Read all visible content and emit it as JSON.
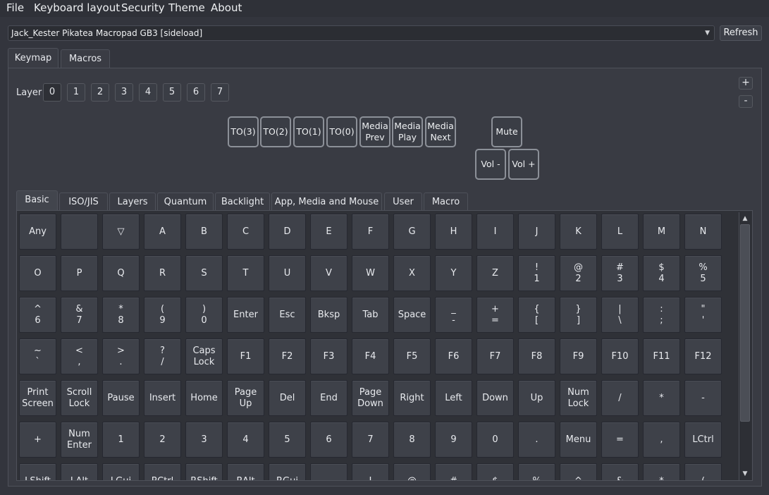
{
  "menu": [
    "File",
    "Keyboard layout",
    "Security",
    "Theme",
    "About"
  ],
  "device": {
    "selected": "Jack_Kester Pikatea Macropad GB3 [sideload]",
    "refresh_label": "Refresh"
  },
  "top_tabs": [
    {
      "label": "Keymap",
      "active": true
    },
    {
      "label": "Macros",
      "active": false
    }
  ],
  "layers": {
    "label": "Layer",
    "items": [
      "0",
      "1",
      "2",
      "3",
      "4",
      "5",
      "6",
      "7"
    ],
    "active_index": 0,
    "plus_label": "+",
    "minus_label": "-"
  },
  "keyboard_keys": [
    {
      "label": "TO(3)"
    },
    {
      "label": "TO(2)"
    },
    {
      "label": "TO(1)"
    },
    {
      "label": "TO(0)"
    },
    {
      "label": "Media\nPrev"
    },
    {
      "label": "Media\nPlay"
    },
    {
      "label": "Media\nNext"
    },
    {
      "label": "Mute"
    },
    {
      "label": "Vol -"
    },
    {
      "label": "Vol +"
    }
  ],
  "category_tabs": [
    {
      "label": "Basic",
      "active": true
    },
    {
      "label": "ISO/JIS"
    },
    {
      "label": "Layers"
    },
    {
      "label": "Quantum"
    },
    {
      "label": "Backlight"
    },
    {
      "label": "App, Media and Mouse"
    },
    {
      "label": "User"
    },
    {
      "label": "Macro"
    }
  ],
  "key_rows": [
    [
      "Any",
      "",
      "▽",
      "A",
      "B",
      "C",
      "D",
      "E",
      "F",
      "G",
      "H",
      "I",
      "J",
      "K",
      "L",
      "M",
      "N"
    ],
    [
      "O",
      "P",
      "Q",
      "R",
      "S",
      "T",
      "U",
      "V",
      "W",
      "X",
      "Y",
      "Z",
      "!\n1",
      "@\n2",
      "#\n3",
      "$\n4",
      "%\n5"
    ],
    [
      "^\n6",
      "&\n7",
      "*\n8",
      "(\n9",
      ")\n0",
      "Enter",
      "Esc",
      "Bksp",
      "Tab",
      "Space",
      "_\n-",
      "+\n=",
      "{\n[",
      "}\n]",
      "|\n\\",
      ":\n;",
      "\"\n'"
    ],
    [
      "~\n`",
      "<\n,",
      ">\n.",
      "?\n/",
      "Caps\nLock",
      "F1",
      "F2",
      "F3",
      "F4",
      "F5",
      "F6",
      "F7",
      "F8",
      "F9",
      "F10",
      "F11",
      "F12"
    ],
    [
      "Print\nScreen",
      "Scroll\nLock",
      "Pause",
      "Insert",
      "Home",
      "Page\nUp",
      "Del",
      "End",
      "Page\nDown",
      "Right",
      "Left",
      "Down",
      "Up",
      "Num\nLock",
      "/",
      "*",
      "-"
    ],
    [
      "+",
      "Num\nEnter",
      "1",
      "2",
      "3",
      "4",
      "5",
      "6",
      "7",
      "8",
      "9",
      "0",
      ".",
      "Menu",
      "=",
      ",",
      "LCtrl"
    ],
    [
      "LShift",
      "LAlt",
      "LGui",
      "RCtrl",
      "RShift",
      "RAlt",
      "RGui",
      "",
      "!",
      "@",
      "#",
      "$",
      "%",
      "^",
      "&",
      "*",
      "("
    ]
  ],
  "icons": {
    "combo_arrow": "▼",
    "scroll_up": "▲",
    "scroll_down": "▼"
  },
  "colors": {
    "background": "#33353d",
    "panel": "#393b43",
    "key_outline": "#8c9098"
  }
}
